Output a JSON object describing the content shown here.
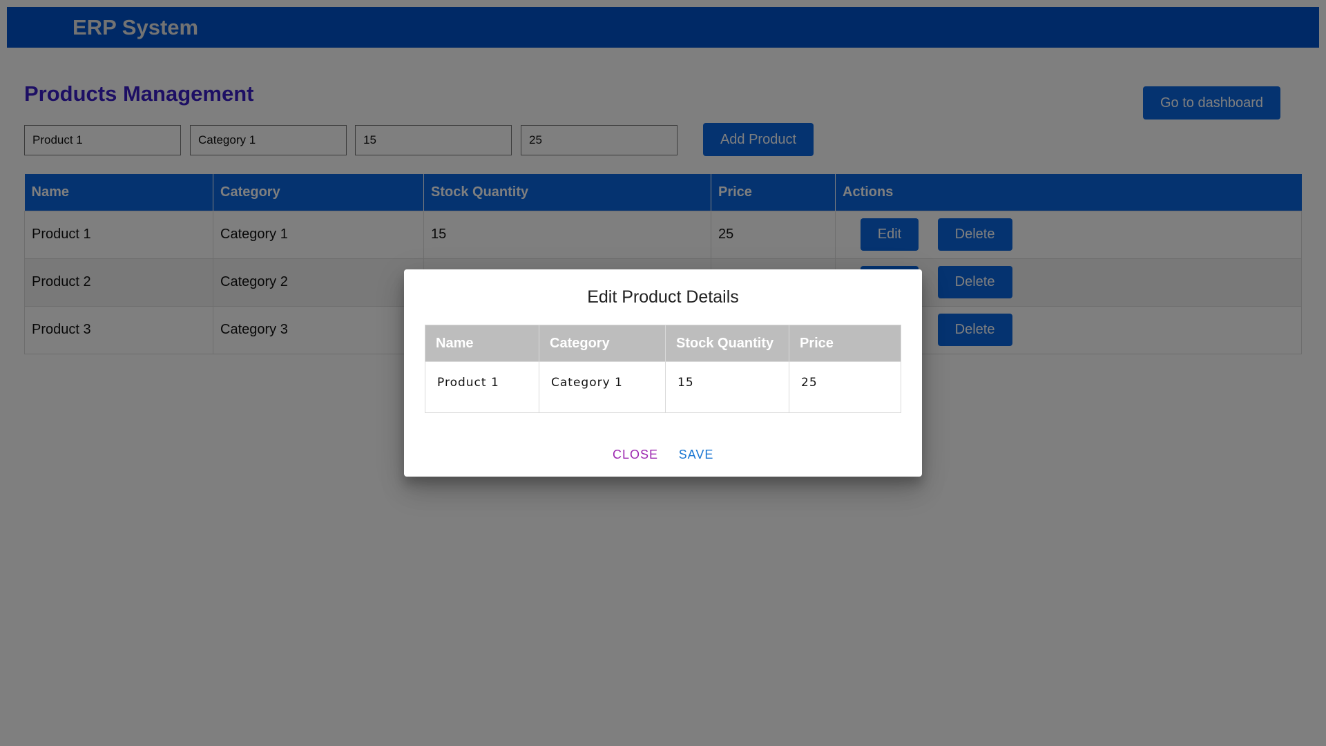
{
  "app": {
    "title": "ERP System"
  },
  "page": {
    "title": "Products Management",
    "dashboard_button": "Go to dashboard"
  },
  "add_form": {
    "name_value": "Product 1",
    "category_value": "Category 1",
    "stock_value": "15",
    "price_value": "25",
    "add_button": "Add Product"
  },
  "table": {
    "headers": [
      "Name",
      "Category",
      "Stock Quantity",
      "Price",
      "Actions"
    ],
    "rows": [
      {
        "name": "Product 1",
        "category": "Category 1",
        "stock": "15",
        "price": "25"
      },
      {
        "name": "Product 2",
        "category": "Category 2",
        "stock": "",
        "price": ""
      },
      {
        "name": "Product 3",
        "category": "Category 3",
        "stock": "",
        "price": ""
      }
    ],
    "edit_label": "Edit",
    "delete_label": "Delete"
  },
  "dialog": {
    "title": "Edit Product Details",
    "headers": [
      "Name",
      "Category",
      "Stock Quantity",
      "Price"
    ],
    "row": {
      "name": "Product 1",
      "category": "Category 1",
      "stock": "15",
      "price": "25"
    },
    "close_label": "CLOSE",
    "save_label": "SAVE"
  },
  "colors": {
    "brand_blue": "#0a66e0",
    "topbar_blue": "#0052cc",
    "title_purple": "#3a1fc8",
    "dialog_header_gray": "#bdbdbd",
    "close_purple": "#9c27b0",
    "save_blue": "#1976d2",
    "overlay": "rgba(0,0,0,0.5)"
  }
}
